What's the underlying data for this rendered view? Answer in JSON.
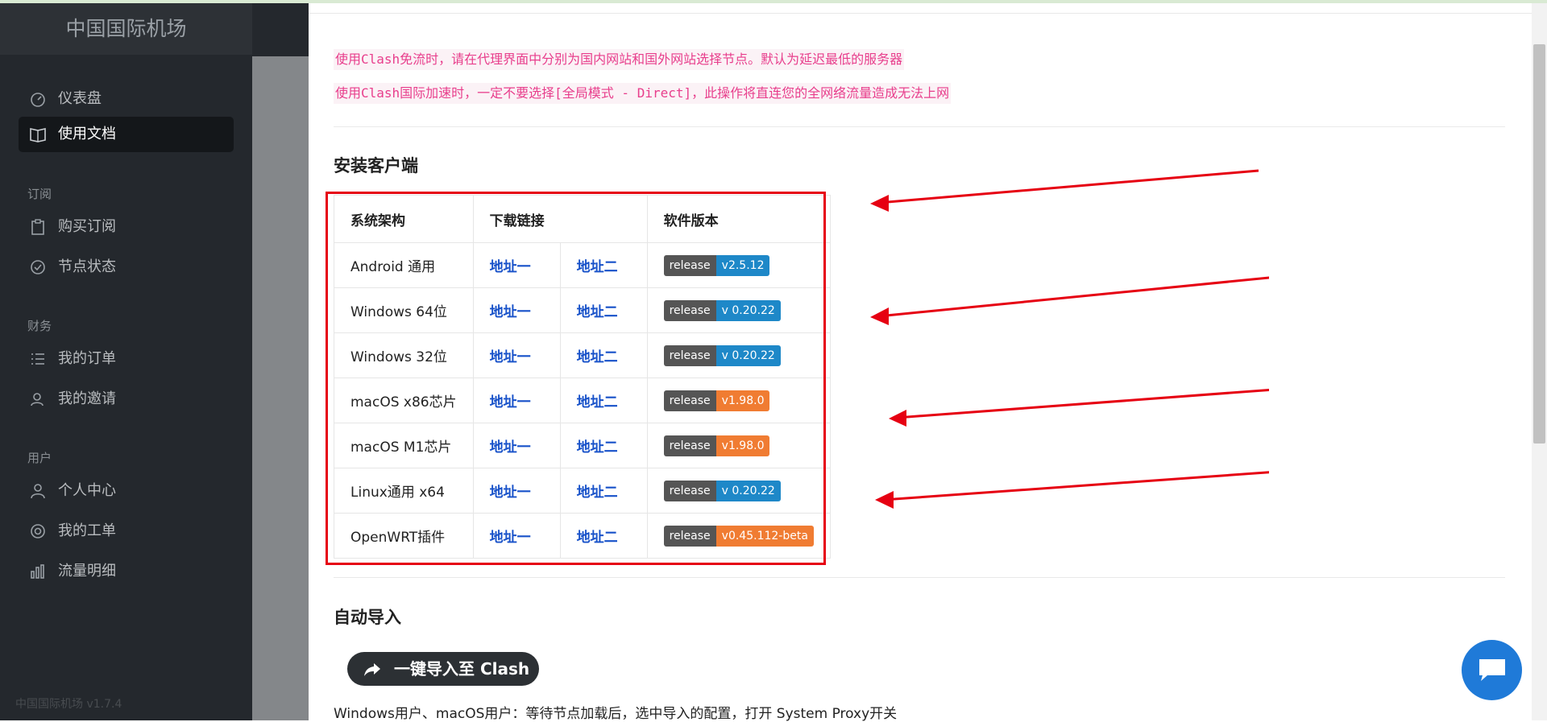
{
  "sidebar": {
    "brand": "中国国际机场",
    "nav_top": [
      {
        "label": "仪表盘",
        "icon": "dashboard-icon"
      },
      {
        "label": "使用文档",
        "icon": "book-icon",
        "active": true
      }
    ],
    "sections": [
      {
        "heading": "订阅",
        "items": [
          {
            "label": "购买订阅",
            "icon": "clipboard-icon"
          },
          {
            "label": "节点状态",
            "icon": "check-circle-icon"
          }
        ]
      },
      {
        "heading": "财务",
        "items": [
          {
            "label": "我的订单",
            "icon": "list-icon"
          },
          {
            "label": "我的邀请",
            "icon": "users-icon"
          }
        ]
      },
      {
        "heading": "用户",
        "items": [
          {
            "label": "个人中心",
            "icon": "user-icon"
          },
          {
            "label": "我的工单",
            "icon": "support-icon"
          },
          {
            "label": "流量明细",
            "icon": "bar-chart-icon"
          }
        ]
      }
    ],
    "version": "中国国际机场 v1.7.4"
  },
  "notices": [
    "使用Clash免流时，请在代理界面中分别为国内网站和国外网站选择节点。默认为延迟最低的服务器",
    "使用Clash国际加速时，一定不要选择[全局模式 - Direct]，此操作将直连您的全网络流量造成无法上网"
  ],
  "install": {
    "title": "安装客户端",
    "headers": {
      "arch": "系统架构",
      "download": "下载链接",
      "version": "软件版本"
    },
    "rows": [
      {
        "os": "Android 通用",
        "link1": "地址一",
        "link2": "地址二",
        "badge_left": "release",
        "badge_right": "v2.5.12",
        "badge_color": "#1e88c8"
      },
      {
        "os": "Windows 64位",
        "link1": "地址一",
        "link2": "地址二",
        "badge_left": "release",
        "badge_right": "v 0.20.22",
        "badge_color": "#1e88c8"
      },
      {
        "os": "Windows 32位",
        "link1": "地址一",
        "link2": "地址二",
        "badge_left": "release",
        "badge_right": "v 0.20.22",
        "badge_color": "#1e88c8"
      },
      {
        "os": "macOS x86芯片",
        "link1": "地址一",
        "link2": "地址二",
        "badge_left": "release",
        "badge_right": "v1.98.0",
        "badge_color": "#f07c32"
      },
      {
        "os": "macOS M1芯片",
        "link1": "地址一",
        "link2": "地址二",
        "badge_left": "release",
        "badge_right": "v1.98.0",
        "badge_color": "#f07c32"
      },
      {
        "os": "Linux通用 x64",
        "link1": "地址一",
        "link2": "地址二",
        "badge_left": "release",
        "badge_right": "v 0.20.22",
        "badge_color": "#1e88c8"
      },
      {
        "os": "OpenWRT插件",
        "link1": "地址一",
        "link2": "地址二",
        "badge_left": "release",
        "badge_right": "v0.45.112-beta",
        "badge_color": "#f07c32"
      }
    ]
  },
  "auto_import": {
    "title": "自动导入",
    "button_label": "一键导入至 Clash",
    "tip": "Windows用户、macOS用户：等待节点加载后，选中导入的配置，打开 System Proxy开关"
  },
  "colors": {
    "annotation_red": "#e60012",
    "chat_blue": "#1f7ad8"
  }
}
